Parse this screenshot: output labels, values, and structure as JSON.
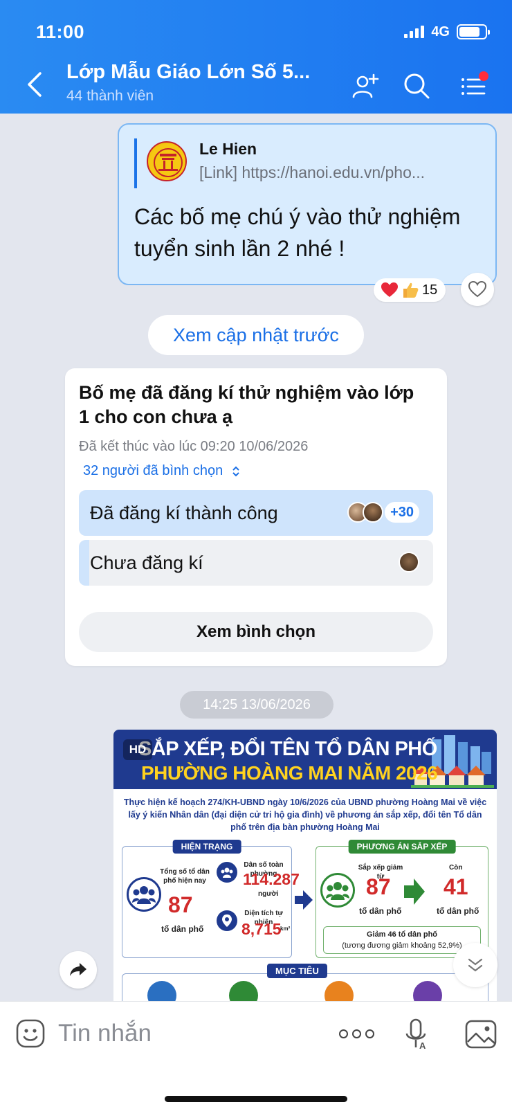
{
  "status": {
    "time": "11:00",
    "network": "4G"
  },
  "header": {
    "title": "Lớp Mẫu Giáo Lớn Số 5...",
    "subtitle": "44 thành viên"
  },
  "message": {
    "quote_name": "Le Hien",
    "quote_link": "[Link] https://hanoi.edu.vn/pho...",
    "text": "Các bố mẹ chú  ý vào thử nghiệm tuyển sinh lần 2 nhé !",
    "reaction_count": "15"
  },
  "prev_updates_label": "Xem cập nhật trước",
  "poll": {
    "question": "Bố mẹ đã đăng kí thử nghiệm vào lớp 1 cho con chưa ạ",
    "ended": "Đã kết thúc vào lúc 09:20 10/06/2026",
    "votes": "32 người đã bình chọn",
    "options": [
      {
        "label": "Đã đăng kí thành công",
        "extra": "+30",
        "fill": 1.0
      },
      {
        "label": "Chưa đăng kí",
        "fill": 0.03
      }
    ],
    "view_label": "Xem bình chọn"
  },
  "timestamp": "14:25 13/06/2026",
  "infographic": {
    "hd": "HD",
    "title1": "SẮP XẾP, ĐỔI TÊN TỔ DÂN PHỐ",
    "title2": "PHƯỜNG HOÀNG MAI NĂM 2026",
    "desc": "Thực hiện kế hoạch 274/KH-UBND ngày 10/6/2026 của UBND phường Hoàng Mai về việc lấy ý kiến Nhân dân (đại diện cử tri hộ gia đình) về phương án sắp xếp, đổi tên Tổ dân phố trên địa bàn phường Hoàng Mai",
    "current_tag": "HIỆN TRẠNG",
    "plan_tag": "PHƯƠNG ÁN SẮP XẾP",
    "total_label": "Tổng số tổ dân phố hiện nay",
    "total_value": "87",
    "total_unit": "tổ dân phố",
    "pop_label": "Dân số toàn phường",
    "pop_value": "114.287",
    "pop_unit": "người",
    "area_label": "Diện tích tự nhiên",
    "area_value": "8,715",
    "area_unit": "km²",
    "reduce_from_label": "Sắp xếp giảm từ",
    "reduce_from": "87",
    "remain_label": "Còn",
    "remain": "41",
    "unit": "tổ dân phố",
    "reduce_note1": "Giảm 46 tổ dân phố",
    "reduce_note2": "(tương đương giảm khoảng 52,9%)",
    "goal_tag": "MỤC TIÊU"
  },
  "input": {
    "placeholder": "Tin nhắn"
  },
  "colors": {
    "header": "#1a73f0",
    "accent": "#1a6fe6",
    "bubble": "#d9ecfe"
  }
}
